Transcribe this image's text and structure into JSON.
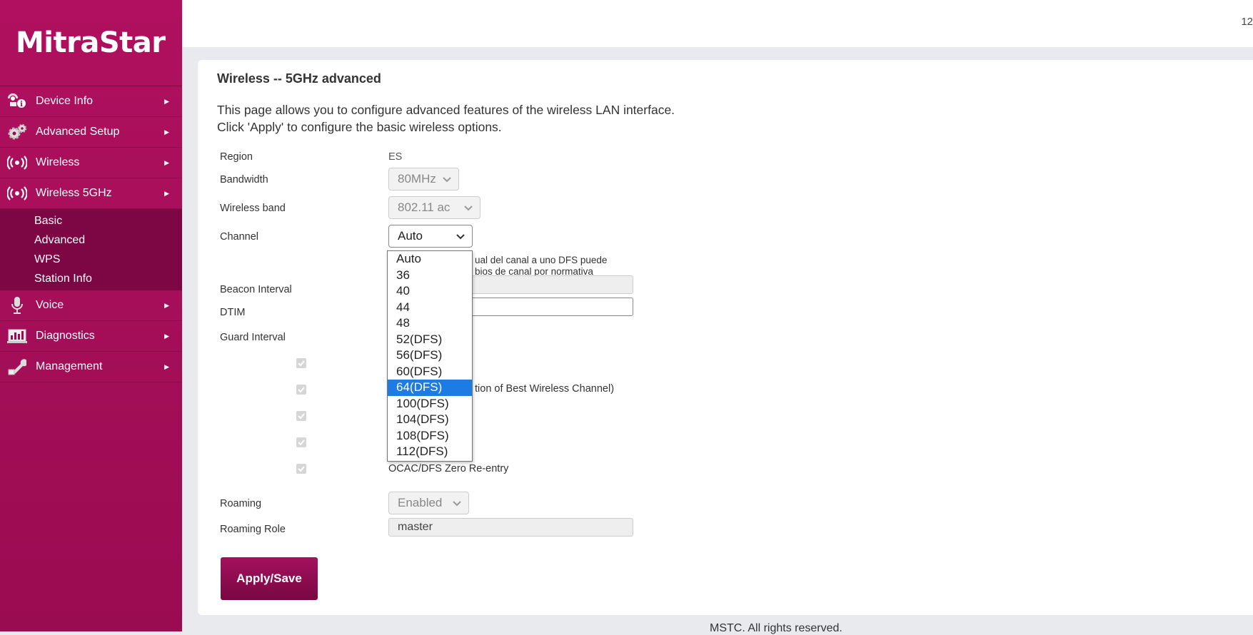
{
  "brand": {
    "logo": "MitraStar"
  },
  "topbar": {
    "right_text": "12"
  },
  "sidebar": {
    "items": [
      {
        "label": "Device Info",
        "icon": "device-info-icon"
      },
      {
        "label": "Advanced Setup",
        "icon": "gears-icon"
      },
      {
        "label": "Wireless",
        "icon": "wireless-icon"
      },
      {
        "label": "Wireless 5GHz",
        "icon": "wireless-icon"
      },
      {
        "label": "Voice",
        "icon": "microphone-icon"
      },
      {
        "label": "Diagnostics",
        "icon": "diagnostics-icon"
      },
      {
        "label": "Management",
        "icon": "wrench-icon"
      }
    ],
    "submenu": [
      "Basic",
      "Advanced",
      "WPS",
      "Station Info"
    ]
  },
  "page": {
    "title": "Wireless -- 5GHz advanced",
    "desc1": "This page allows you to configure advanced features of the wireless LAN interface.",
    "desc2": "Click 'Apply' to configure the basic wireless options."
  },
  "form": {
    "region_label": "Region",
    "region_value": "ES",
    "bandwidth_label": "Bandwidth",
    "bandwidth_value": "80MHz",
    "band_label": "Wireless band",
    "band_value": "802.11 ac",
    "channel_label": "Channel",
    "channel_value": "Auto",
    "channel_note1": "ual del canal a uno DFS puede",
    "channel_note2": "bios de canal por normativa",
    "beacon_label": "Beacon Interval",
    "dtim_label": "DTIM",
    "guard_label": "Guard Interval",
    "best_channel_note": "tion of Best Wireless Channel)",
    "ocac_label": "OCAC/DFS Zero Re-entry",
    "roaming_label": "Roaming",
    "roaming_value": "Enabled",
    "role_label": "Roaming Role",
    "role_value": "master"
  },
  "channel_options": [
    "Auto",
    "36",
    "40",
    "44",
    "48",
    "52(DFS)",
    "56(DFS)",
    "60(DFS)",
    "64(DFS)",
    "100(DFS)",
    "104(DFS)",
    "108(DFS)",
    "112(DFS)"
  ],
  "channel_highlighted": "64(DFS)",
  "apply_label": "Apply/Save",
  "footer": "MSTC. All rights reserved.",
  "colors": {
    "brand": "#b0105f",
    "highlight": "#1e7be3"
  }
}
